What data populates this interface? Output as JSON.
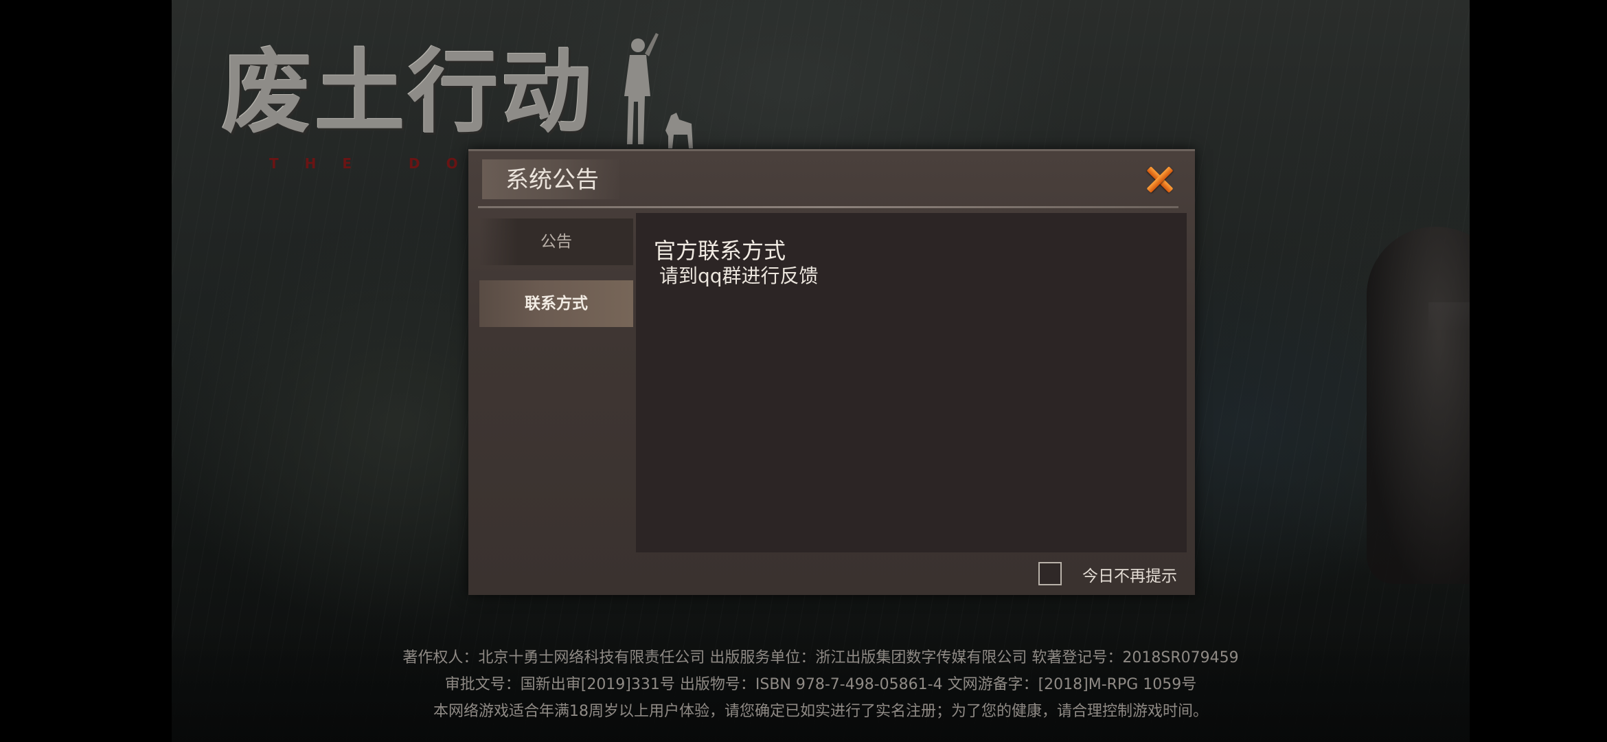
{
  "logo": {
    "title": "废土行动",
    "subtitle": "THE DOOMS"
  },
  "dialog": {
    "title": "系统公告",
    "tabs": [
      {
        "label": "公告",
        "selected": false
      },
      {
        "label": "联系方式",
        "selected": true
      }
    ],
    "content": {
      "heading": "官方联系方式",
      "body": "请到qq群进行反馈"
    },
    "dont_show_today": {
      "label": "今日不再提示",
      "checked": false
    }
  },
  "footer": {
    "line1": "著作权人：北京十勇士网络科技有限责任公司   出版服务单位：浙江出版集团数字传媒有限公司     软著登记号：2018SR079459",
    "line2": "审批文号：国新出审[2019]331号    出版物号：ISBN 978-7-498-05861-4     文网游备字：[2018]M-RPG 1059号",
    "line3": "本网络游戏适合年满18周岁以上用户体验，请您确定已如实进行了实名注册；为了您的健康，请合理控制游戏时间。"
  },
  "colors": {
    "close_accent": "#e9781f",
    "selected_tab": "#6b5b51",
    "dialog_bg": "#3f3633",
    "content_bg": "#2c2525"
  },
  "icons": {
    "close": "close-x-icon",
    "checkbox": "checkbox-empty-icon"
  }
}
